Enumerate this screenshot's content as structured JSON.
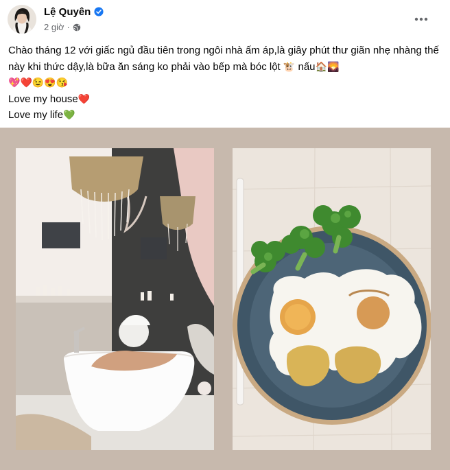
{
  "post": {
    "author": "Lệ Quyên",
    "time": "2 giờ",
    "caption_text": "Chào tháng 12 với giấc ngủ đầu tiên trong ngôi nhà ấm áp,là giây phút thư giãn nhẹ nhàng thế này khi thức dậy,là bữa ăn sáng ko phải vào bếp mà bóc lột ",
    "caption_after_cow": " nấu",
    "emoji_line_1": [
      "🐮",
      "🏠",
      "🌄"
    ],
    "emoji_line_2": [
      "💖",
      "❤️",
      "😉",
      "😍",
      "😘"
    ],
    "line_house": "Love my house",
    "emoji_house": "❤️",
    "line_life": "Love my life",
    "emoji_life": "💚"
  },
  "icons": {
    "verified": "verified-badge-icon",
    "privacy": "globe-icon",
    "more": "more-dots-icon"
  },
  "photos": [
    {
      "subject": "bathroom-photo"
    },
    {
      "subject": "breakfast-plate-photo"
    }
  ],
  "colors": {
    "accent": "#1877f2",
    "secondary_text": "#65676b",
    "photo_background": "#c7b9ad"
  }
}
